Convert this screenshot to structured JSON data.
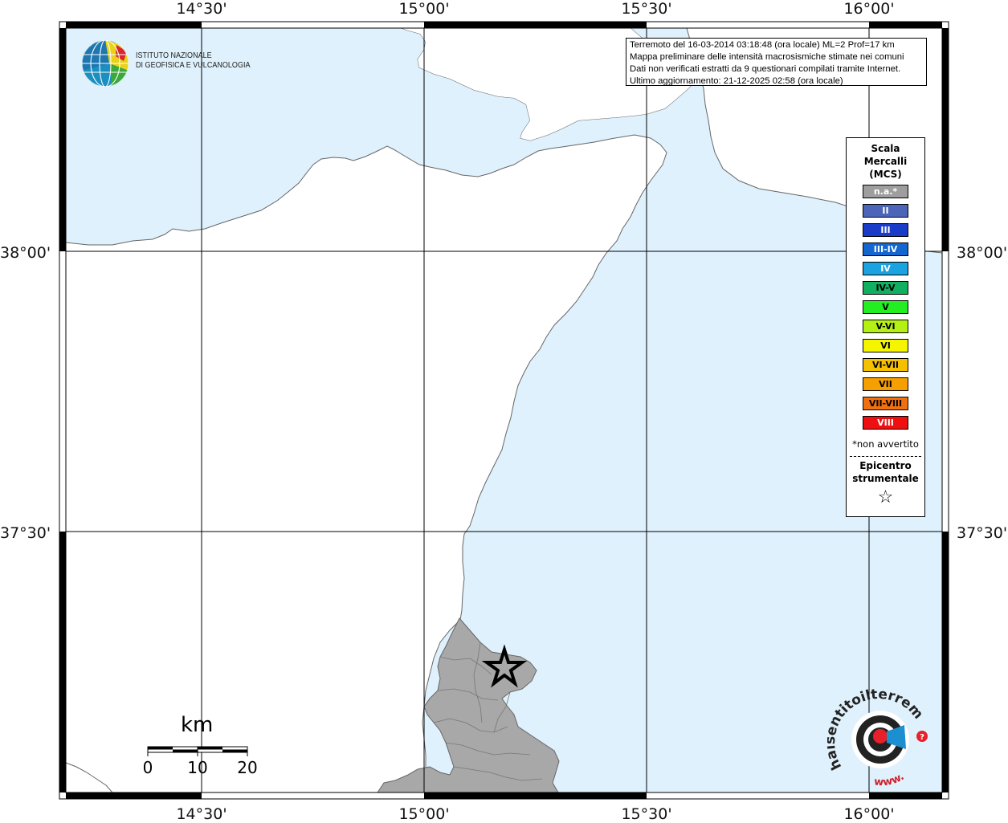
{
  "map": {
    "title_lines": [
      "Terremoto del 16-03-2014 03:18:48 (ora locale) ML=2 Prof=17 km",
      "Mappa preliminare delle intensità macrosismiche stimate nei comuni",
      "Dati non verificati estratti da 9 questionari compilati tramite Internet.",
      "Ultimo aggiornamento: 21-12-2025 02:58 (ora locale)"
    ],
    "longitude_labels": [
      "14°30'",
      "15°00'",
      "15°30'",
      "16°00'"
    ],
    "latitude_labels": [
      "38°00'",
      "37°30'"
    ],
    "colors": {
      "sea": "#dff1fc",
      "land": "#ffffff",
      "affected_area": "#a8a8a8",
      "coast": "#666666",
      "grid": "#000000"
    }
  },
  "organization": {
    "name_line1": "ISTITUTO NAZIONALE",
    "name_line2": "DI GEOFISICA E VULCANOLOGIA"
  },
  "legend": {
    "title_lines": [
      "Scala",
      "Mercalli",
      "(MCS)"
    ],
    "levels": [
      {
        "label": "n.a.*",
        "color": "#9e9e9e",
        "text_color": "#ffffff"
      },
      {
        "label": "II",
        "color": "#4d65b8",
        "text_color": "#ffffff"
      },
      {
        "label": "III",
        "color": "#1a3cc8",
        "text_color": "#ffffff"
      },
      {
        "label": "III-IV",
        "color": "#1467d0",
        "text_color": "#ffffff"
      },
      {
        "label": "IV",
        "color": "#1aa3e0",
        "text_color": "#ffffff"
      },
      {
        "label": "IV-V",
        "color": "#10b060",
        "text_color": "#000000"
      },
      {
        "label": "V",
        "color": "#22ee22",
        "text_color": "#000000"
      },
      {
        "label": "V-VI",
        "color": "#b4f014",
        "text_color": "#000000"
      },
      {
        "label": "VI",
        "color": "#f5f500",
        "text_color": "#000000"
      },
      {
        "label": "VI-VII",
        "color": "#f5c000",
        "text_color": "#000000"
      },
      {
        "label": "VII",
        "color": "#f5a000",
        "text_color": "#000000"
      },
      {
        "label": "VII-VIII",
        "color": "#f07010",
        "text_color": "#000000"
      },
      {
        "label": "VIII",
        "color": "#ee1010",
        "text_color": "#ffffff"
      }
    ],
    "note": "*non avvertito",
    "epicenter_lines": [
      "Epicentro",
      "strumentale"
    ],
    "epicenter_symbol": "☆"
  },
  "scale_bar": {
    "unit": "km",
    "ticks": [
      "0",
      "10",
      "20"
    ]
  },
  "site_logo": {
    "text": "haisentitoilterremoto.it",
    "www": "www."
  }
}
